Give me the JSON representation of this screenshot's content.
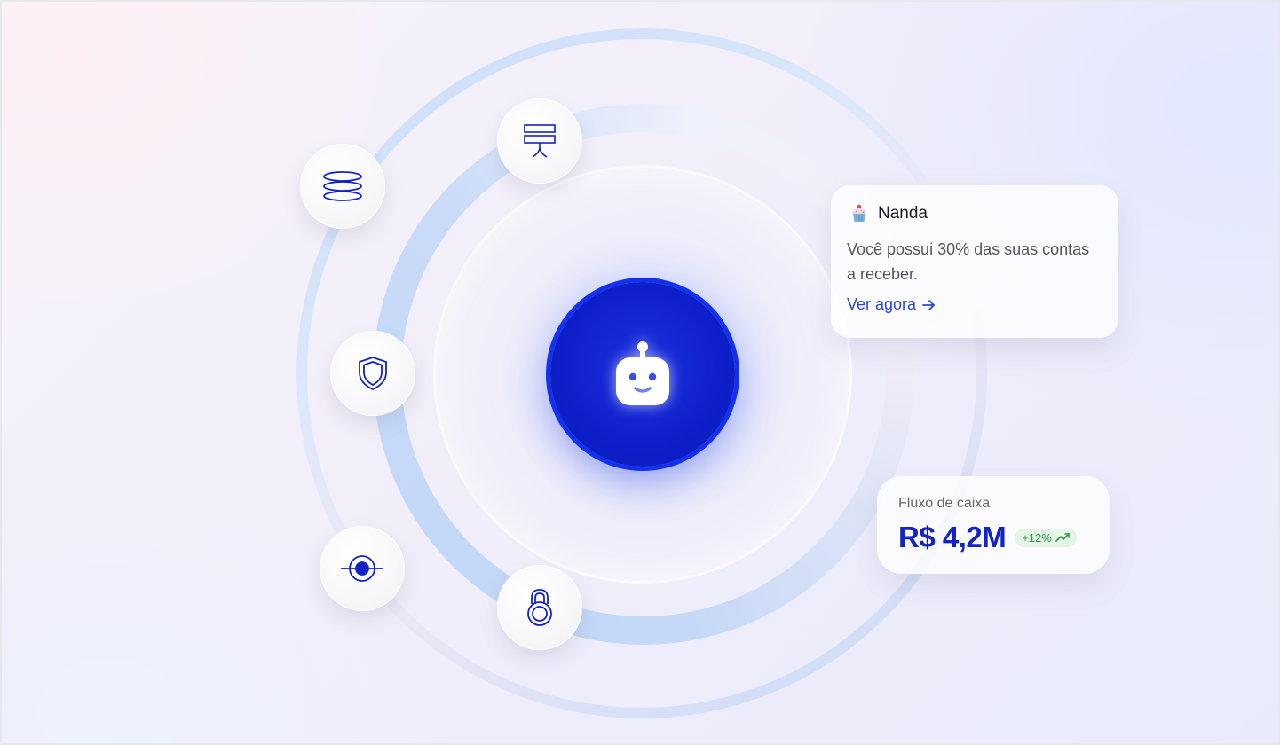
{
  "orbit": {
    "core_icon": "robot-icon",
    "nodes": [
      {
        "icon": "sign-post-icon"
      },
      {
        "icon": "coin-stack-icon"
      },
      {
        "icon": "shield-icon"
      },
      {
        "icon": "eye-scan-icon"
      },
      {
        "icon": "padlock-icon"
      }
    ]
  },
  "assistant_card": {
    "avatar_icon": "cupcake-icon",
    "name": "Nanda",
    "message": "Você possui 30% das suas contas a receber.",
    "link_label": "Ver agora",
    "link_icon": "arrow-right-icon"
  },
  "cashflow_card": {
    "label": "Fluxo de caixa",
    "value": "R$ 4,2M",
    "change": "+12%",
    "trend_icon": "trend-up-icon"
  },
  "colors": {
    "brand_blue": "#1423c4",
    "link_blue": "#2b45d8",
    "positive_green": "#2f9a47"
  }
}
